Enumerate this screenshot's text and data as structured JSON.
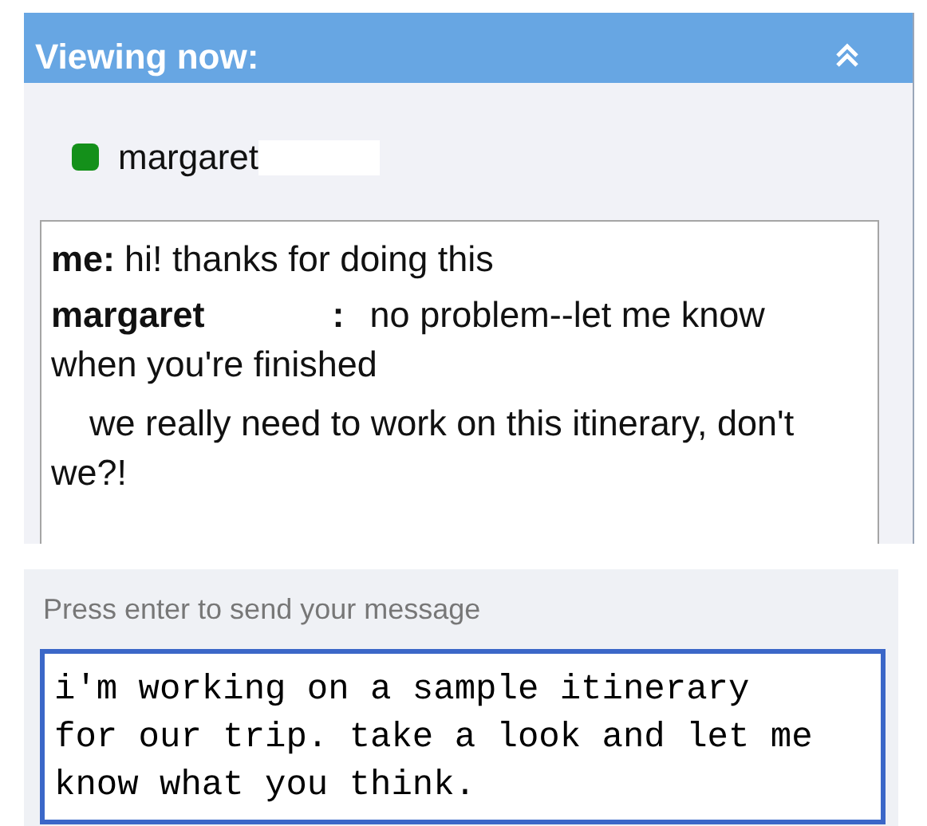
{
  "header": {
    "title": "Viewing now:"
  },
  "viewers": [
    {
      "name": "margaret",
      "color": "#14901a"
    }
  ],
  "messages": [
    {
      "kind": "message",
      "sender": "me",
      "separator": ":",
      "redacted": false,
      "text": "hi! thanks for doing this"
    },
    {
      "kind": "message",
      "sender": "margaret",
      "separator": ":",
      "redacted": true,
      "text": "no problem--let me know when you're finished"
    },
    {
      "kind": "continuation",
      "text": "we really need to work on this itinerary, don't we?!"
    }
  ],
  "composer": {
    "hint": "Press enter to send your message",
    "value": "i'm working on a sample itinerary for our trip. take a look and let me know what you think."
  }
}
